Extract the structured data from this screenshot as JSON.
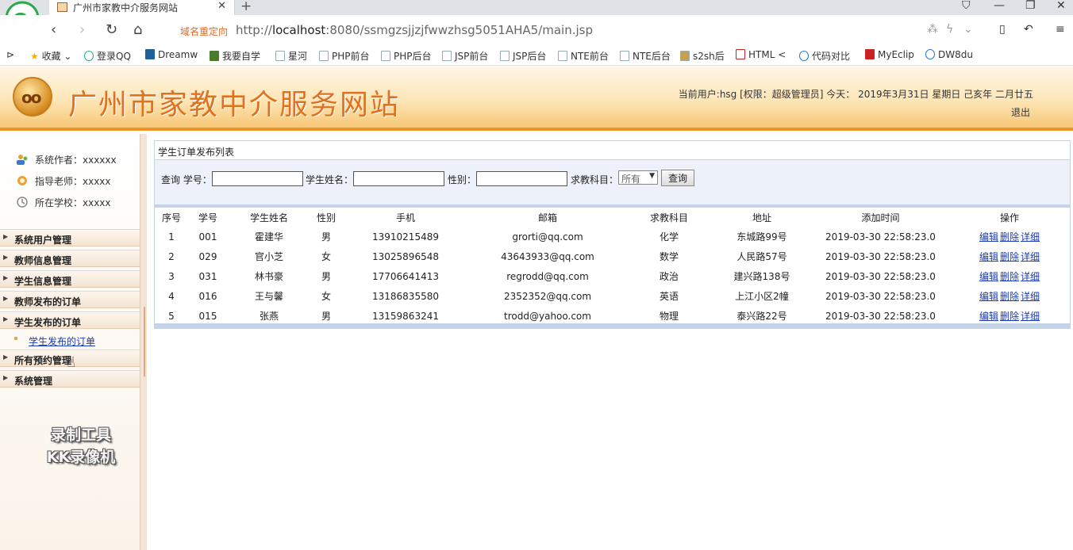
{
  "browser": {
    "tab_title": "广州市家教中介服务网站",
    "tab_close": "✕",
    "new_tab": "+",
    "redirect_label": "域名重定向",
    "url_prefix": "http://",
    "url_host": "localhost",
    "url_rest": ":8080/ssmgzsjjzjfwwzhsg5051AHA5/main.jsp",
    "bookmarks": [
      "收藏",
      "登录QQ",
      "Dreamw",
      "我要自学",
      "星河",
      "PHP前台",
      "PHP后台",
      "JSP前台",
      "JSP后台",
      "NTE前台",
      "NTE后台",
      "s2sh后",
      "HTML <",
      "代码对比",
      "MyEclip",
      "DW8du"
    ]
  },
  "header": {
    "logo_text": "oo",
    "title": "广州市家教中介服务网站",
    "user_info": "当前用户:hsg [权限：超级管理员] 今天： 2019年3月31日 星期日 己亥年 二月廿五",
    "logout": "退出"
  },
  "sidebar": {
    "info": [
      {
        "label": "系统作者：xxxxxx",
        "icon": "users-icon"
      },
      {
        "label": "指导老师：xxxxx",
        "icon": "teacher-icon"
      },
      {
        "label": "所在学校：xxxxx",
        "icon": "school-icon"
      }
    ],
    "menus": [
      "系统用户管理",
      "教师信息管理",
      "学生信息管理",
      "教师发布的订单",
      "学生发布的订单",
      "所有预约管理",
      "系统管理"
    ],
    "submenu_student_orders": "学生发布的订单",
    "watermark_line1": "录制工具",
    "watermark_line2": "KK录像机"
  },
  "main": {
    "panel_title": "学生订单发布列表",
    "search": {
      "query_label": "查询",
      "student_no_label": "学号：",
      "student_name_label": "学生姓名：",
      "gender_label": "性别：",
      "subject_label": "求教科目：",
      "subject_selected": "所有",
      "query_button": "查询"
    },
    "columns": [
      "序号",
      "学号",
      "学生姓名",
      "性别",
      "手机",
      "邮箱",
      "求教科目",
      "地址",
      "添加时间",
      "操作"
    ],
    "rows": [
      {
        "idx": "1",
        "no": "001",
        "name": "霍建华",
        "gender": "男",
        "phone": "13910215489",
        "email": "grorti@qq.com",
        "subject": "化学",
        "address": "东城路99号",
        "time": "2019-03-30 22:58:23.0"
      },
      {
        "idx": "2",
        "no": "029",
        "name": "官小芝",
        "gender": "女",
        "phone": "13025896548",
        "email": "43643933@qq.com",
        "subject": "数学",
        "address": "人民路57号",
        "time": "2019-03-30 22:58:23.0"
      },
      {
        "idx": "3",
        "no": "031",
        "name": "林书豪",
        "gender": "男",
        "phone": "17706641413",
        "email": "regrodd@qq.com",
        "subject": "政治",
        "address": "建兴路138号",
        "time": "2019-03-30 22:58:23.0"
      },
      {
        "idx": "4",
        "no": "016",
        "name": "王与馨",
        "gender": "女",
        "phone": "13186835580",
        "email": "2352352@qq.com",
        "subject": "英语",
        "address": "上江小区2幢",
        "time": "2019-03-30 22:58:23.0"
      },
      {
        "idx": "5",
        "no": "015",
        "name": "张燕",
        "gender": "男",
        "phone": "13159863241",
        "email": "trodd@yahoo.com",
        "subject": "物理",
        "address": "泰兴路22号",
        "time": "2019-03-30 22:58:23.0"
      }
    ],
    "ops": {
      "edit": "编辑",
      "delete": "删除",
      "detail": "详细"
    }
  }
}
